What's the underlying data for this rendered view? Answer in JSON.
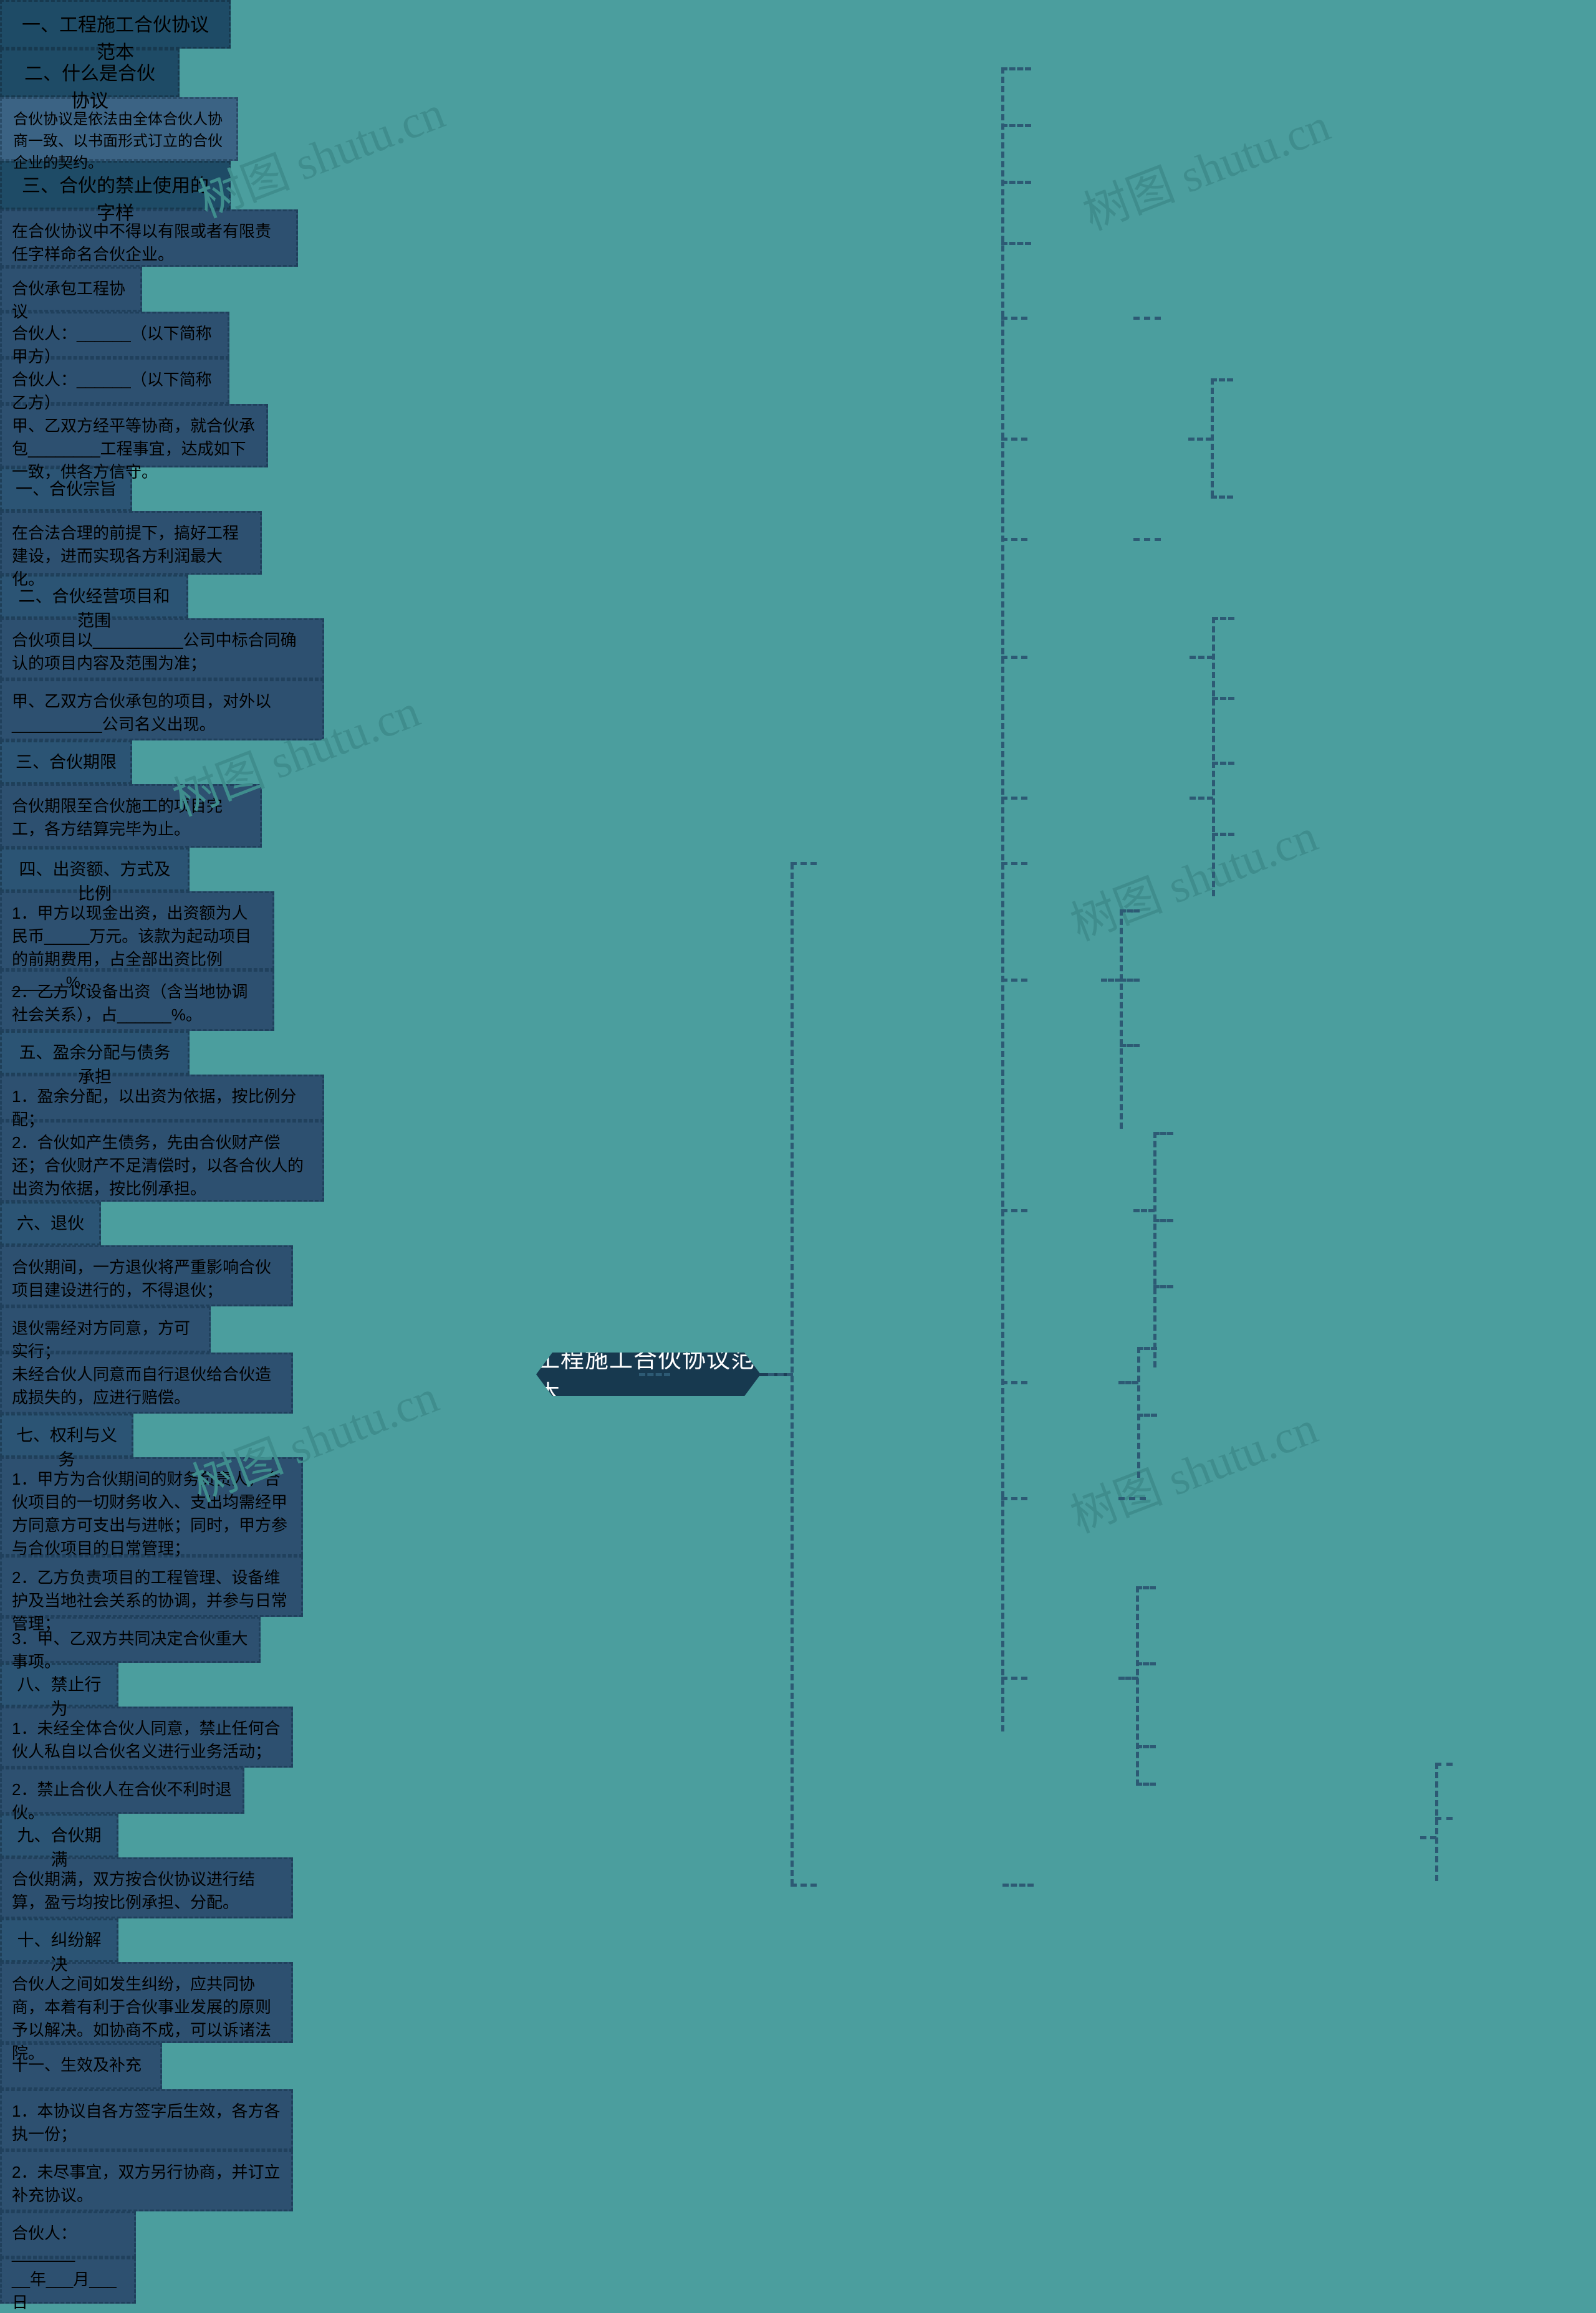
{
  "meta": {
    "background_color": "#4b9e9e",
    "node_color": "#2d5070",
    "branch_color": "#1e4b66",
    "root_color": "#17394f",
    "connector_color": "#2d5a74"
  },
  "watermark": {
    "text": "树图 shutu.cn"
  },
  "root": {
    "label": "工程施工合伙协议范本"
  },
  "branches": {
    "b1": {
      "label": "一、工程施工合伙协议范本"
    },
    "b2": {
      "label": "二、什么是合伙协议"
    },
    "b3": {
      "label": "三、合伙的禁止使用的字样"
    }
  },
  "definition": {
    "text": "合伙协议是依法由全体合伙人协商一致、以书面形式订立的合伙企业的契约。"
  },
  "forbidden": {
    "text": "在合伙协议中不得以有限或者有限责任字样命名合伙企业。"
  },
  "preamble": {
    "title": "合伙承包工程协议",
    "party_a": "合伙人：______（以下简称甲方）",
    "party_b": "合伙人：______（以下简称乙方）",
    "intro": "甲、乙双方经平等协商，就合伙承包________工程事宜，达成如下一致，供各方信守。"
  },
  "sections": [
    {
      "label": "一、合伙宗旨",
      "items": [
        "在合法合理的前提下，搞好工程建设，进而实现各方利润最大化。"
      ]
    },
    {
      "label": "二、合伙经营项目和范围",
      "items": [
        "合伙项目以__________公司中标合同确认的项目内容及范围为准；",
        "甲、乙双方合伙承包的项目，对外以__________公司名义出现。"
      ]
    },
    {
      "label": "三、合伙期限",
      "items": [
        "合伙期限至合伙施工的项目完工，各方结算完毕为止。"
      ]
    },
    {
      "label": "四、出资额、方式及比例",
      "items": [
        "1．甲方以现金出资，出资额为人民币_____万元。该款为起动项目的前期费用，占全部出资比例______%。",
        "2．乙方以设备出资（含当地协调社会关系），占______%。"
      ]
    },
    {
      "label": "五、盈余分配与债务承担",
      "items": [
        "1．盈余分配，以出资为依据，按比例分配；",
        "2．合伙如产生债务，先由合伙财产偿还；合伙财产不足清偿时，以各合伙人的出资为依据，按比例承担。"
      ]
    },
    {
      "label": "六、退伙",
      "items": [
        "合伙期间，一方退伙将严重影响合伙项目建设进行的，不得退伙；",
        "退伙需经对方同意，方可实行；",
        "未经合伙人同意而自行退伙给合伙造成损失的，应进行赔偿。"
      ]
    },
    {
      "label": "七、权利与义务",
      "items": [
        "1．甲方为合伙期间的财务负责人，合伙项目的一切财务收入、支出均需经甲方同意方可支出与进帐；同时，甲方参与合伙项目的日常管理；",
        "2．乙方负责项目的工程管理、设备维护及当地社会关系的协调，并参与日常管理；",
        "3．甲、乙双方共同决定合伙重大事项。"
      ]
    },
    {
      "label": "八、禁止行为",
      "items": [
        "1．未经全体合伙人同意，禁止任何合伙人私自以合伙名义进行业务活动；",
        "2．禁止合伙人在合伙不利时退伙。"
      ]
    },
    {
      "label": "九、合伙期满",
      "items": [
        "合伙期满，双方按合伙协议进行结算，盈亏均按比例承担、分配。"
      ]
    },
    {
      "label": "十、纠纷解决",
      "items": [
        "合伙人之间如发生纠纷，应共同协商，本着有利于合伙事业发展的原则予以解决。如协商不成，可以诉诸法院。",
        "十一、生效及补充",
        "1．本协议自各方签字后生效，各方各执一份；",
        "2．未尽事宜，双方另行协商，并订立补充协议。"
      ]
    }
  ],
  "signature": {
    "partner": "合伙人：_______",
    "date": "__年___月___日"
  }
}
